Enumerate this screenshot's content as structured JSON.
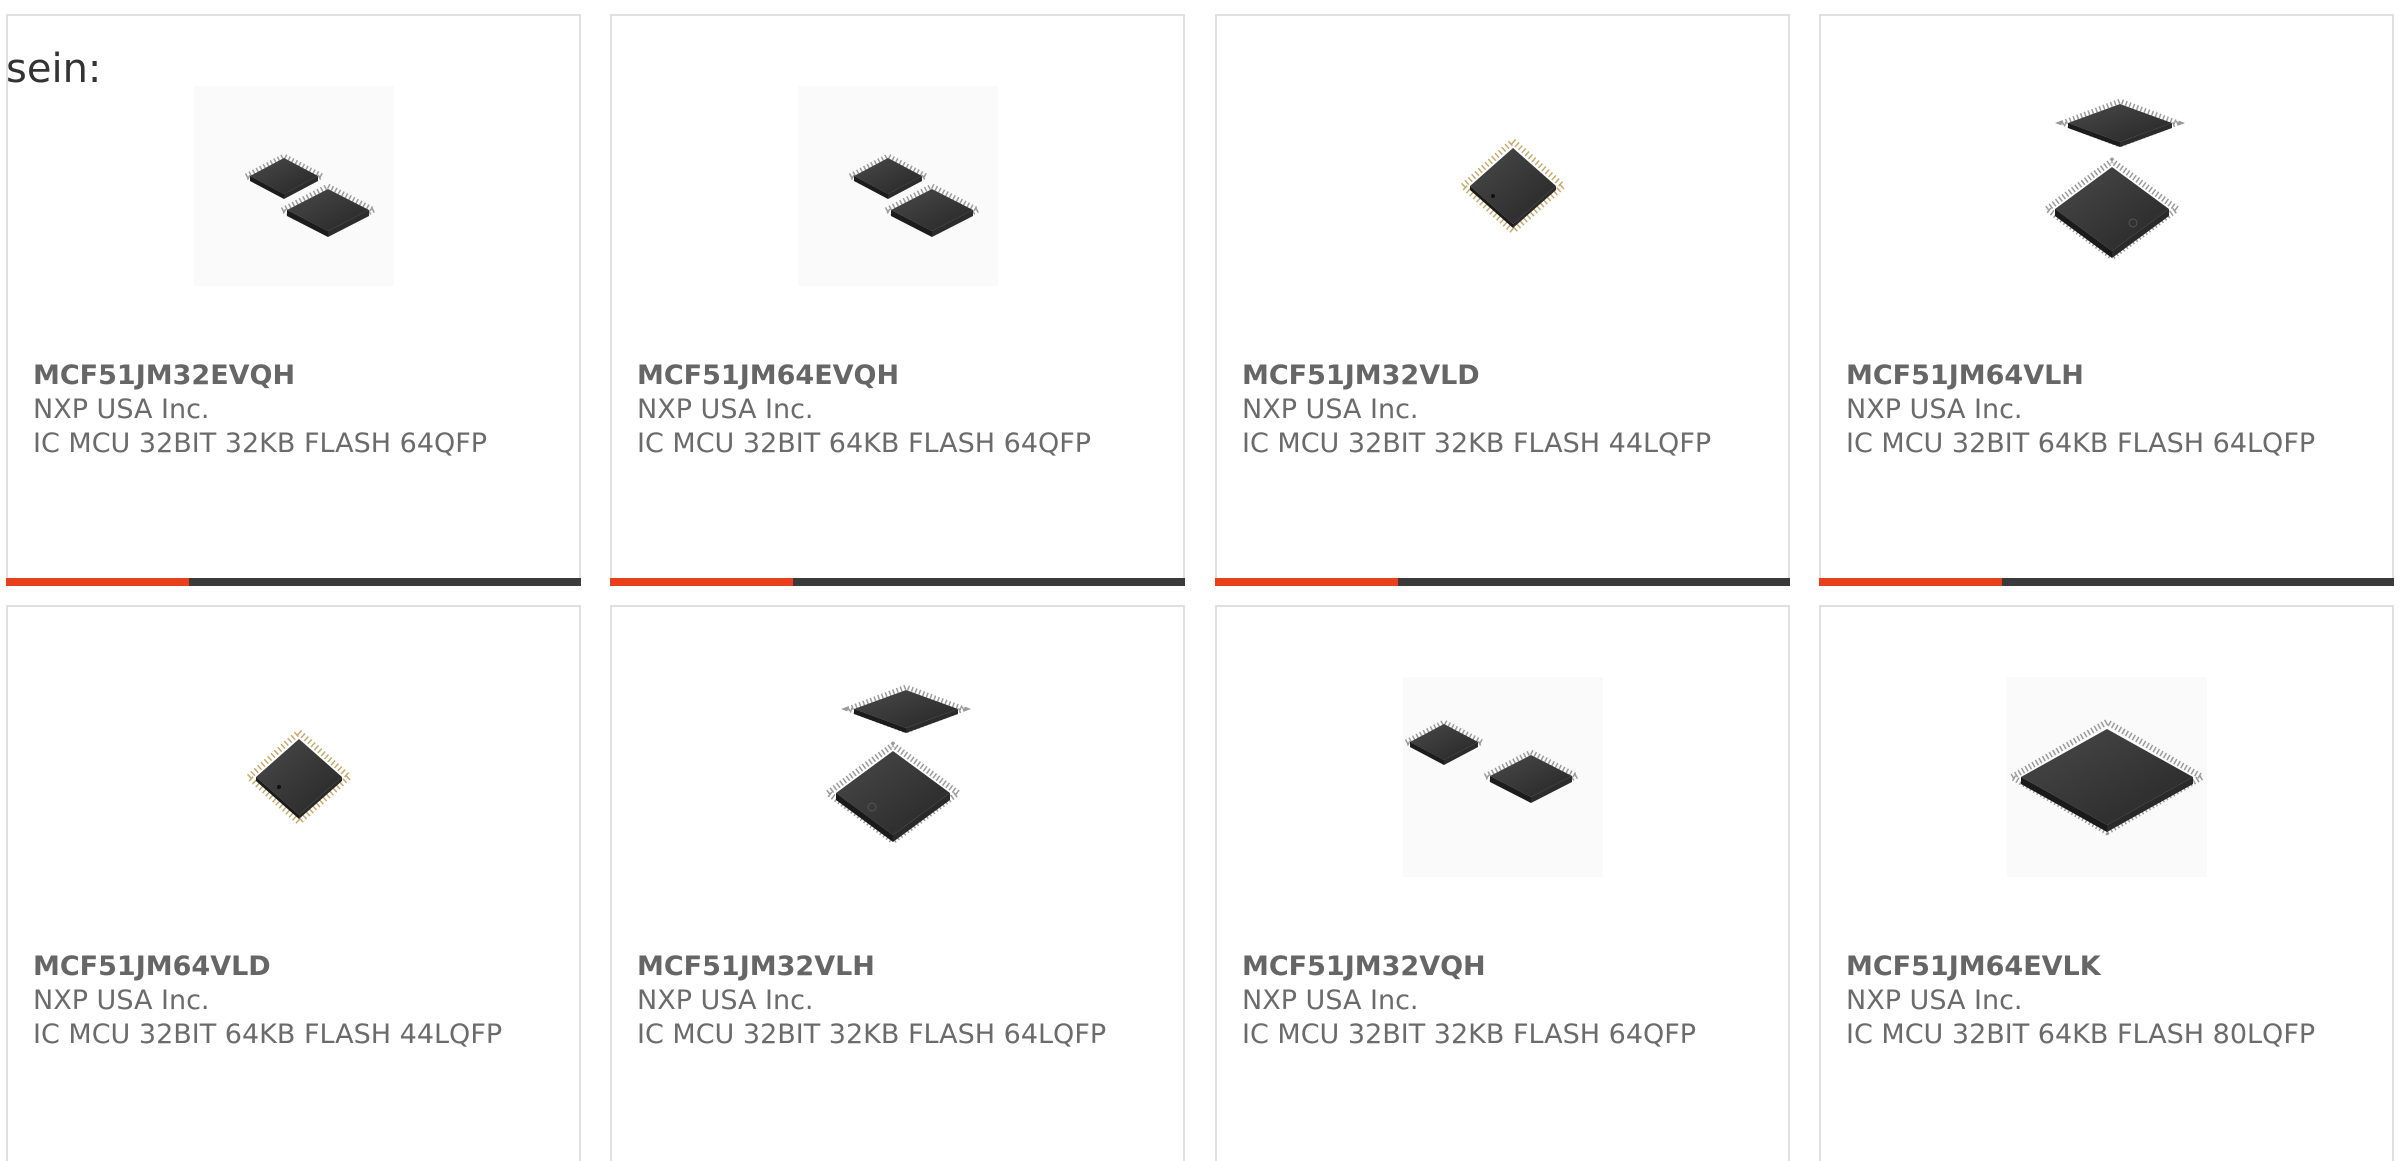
{
  "intro_text": "sein:",
  "accent_color": "#e8401c",
  "bar_color": "#3a3a3a",
  "products": [
    {
      "part_number": "MCF51JM32EVQH",
      "manufacturer": "NXP USA Inc.",
      "description": "IC MCU 32BIT 32KB FLASH 64QFP",
      "image_icon": "two-qfp-chips-icon"
    },
    {
      "part_number": "MCF51JM64EVQH",
      "manufacturer": "NXP USA Inc.",
      "description": "IC MCU 32BIT 64KB FLASH 64QFP",
      "image_icon": "two-qfp-chips-icon"
    },
    {
      "part_number": "MCF51JM32VLD",
      "manufacturer": "NXP USA Inc.",
      "description": "IC MCU 32BIT 32KB FLASH 44LQFP",
      "image_icon": "single-lqfp-chip-icon"
    },
    {
      "part_number": "MCF51JM64VLH",
      "manufacturer": "NXP USA Inc.",
      "description": "IC MCU 32BIT 64KB FLASH 64LQFP",
      "image_icon": "stacked-lqfp-chips-icon"
    },
    {
      "part_number": "MCF51JM64VLD",
      "manufacturer": "NXP USA Inc.",
      "description": "IC MCU 32BIT 64KB FLASH 44LQFP",
      "image_icon": "single-lqfp-chip-icon"
    },
    {
      "part_number": "MCF51JM32VLH",
      "manufacturer": "NXP USA Inc.",
      "description": "IC MCU 32BIT 32KB FLASH 64LQFP",
      "image_icon": "stacked-lqfp-chips-icon"
    },
    {
      "part_number": "MCF51JM32VQH",
      "manufacturer": "NXP USA Inc.",
      "description": "IC MCU 32BIT 32KB FLASH 64QFP",
      "image_icon": "two-qfp-chips-icon"
    },
    {
      "part_number": "MCF51JM64EVLK",
      "manufacturer": "NXP USA Inc.",
      "description": "IC MCU 32BIT 64KB FLASH 80LQFP",
      "image_icon": "large-lqfp-chip-icon"
    }
  ]
}
